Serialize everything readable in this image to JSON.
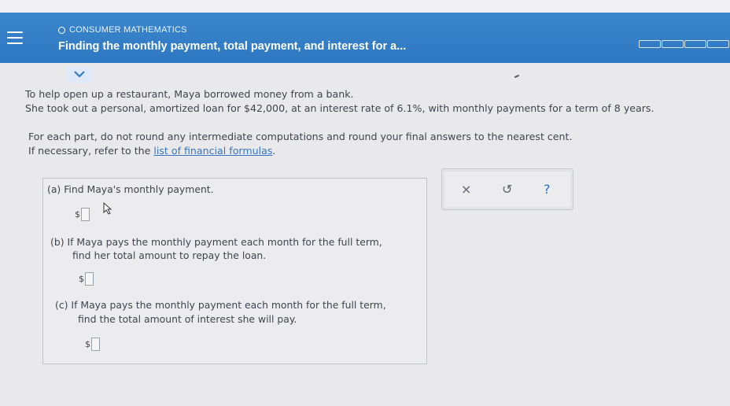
{
  "header": {
    "topic": "CONSUMER MATHEMATICS",
    "title": "Finding the monthly payment, total payment, and interest for a..."
  },
  "problem": {
    "line1": "To help open up a restaurant, Maya borrowed money from a bank.",
    "line2": "She took out a personal, amortized loan for $42,000, at an interest rate of 6.1%, with monthly payments for a term of 8 years.",
    "instr1": "For each part, do not round any intermediate computations and round your final answers to the nearest cent.",
    "instr2_prefix": "If necessary, refer to the ",
    "instr2_link": "list of financial formulas",
    "instr2_suffix": "."
  },
  "parts": {
    "a": {
      "label": "(a)  Find Maya's monthly payment.",
      "currency": "$",
      "value": ""
    },
    "b": {
      "line1": "(b)  If Maya pays the monthly payment each month for the full term,",
      "line2": "find her total amount to repay the loan.",
      "currency": "$",
      "value": ""
    },
    "c": {
      "line1": "(c)  If Maya pays the monthly payment each month for the full term,",
      "line2": "find the total amount of interest she will pay.",
      "currency": "$",
      "value": ""
    }
  },
  "toolbar": {
    "clear_icon": "x-icon",
    "undo_icon": "undo-icon",
    "help_icon": "help-icon",
    "clear_glyph": "×",
    "undo_glyph": "↺",
    "help_glyph": "?"
  },
  "colors": {
    "header_bg": "#2f7cc5",
    "link": "#3476c4",
    "help": "#2f6fc2"
  }
}
